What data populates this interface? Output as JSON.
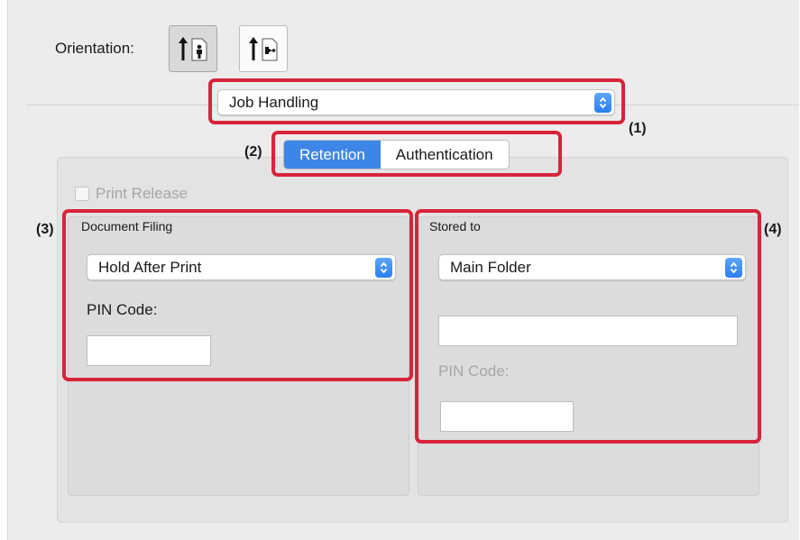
{
  "orientation": {
    "label": "Orientation:",
    "options": [
      {
        "name": "portrait",
        "selected": true
      },
      {
        "name": "landscape",
        "selected": false
      }
    ]
  },
  "job_handling": {
    "value": "Job Handling"
  },
  "tabs": [
    {
      "label": "Retention",
      "active": true
    },
    {
      "label": "Authentication",
      "active": false
    }
  ],
  "print_release": {
    "label": "Print Release",
    "checked": false,
    "enabled": false
  },
  "document_filing": {
    "title": "Document Filing",
    "mode_value": "Hold After Print",
    "pin_label": "PIN Code:",
    "pin_value": ""
  },
  "stored_to": {
    "title": "Stored to",
    "folder_value": "Main Folder",
    "text_value": "",
    "pin_label": "PIN Code:",
    "pin_value": "",
    "pin_enabled": false
  },
  "callouts": {
    "c1": "(1)",
    "c2": "(2)",
    "c3": "(3)",
    "c4": "(4)"
  },
  "colors": {
    "accent": "#3d86e8",
    "highlight": "#d7243b",
    "window_bg": "#ececec"
  }
}
